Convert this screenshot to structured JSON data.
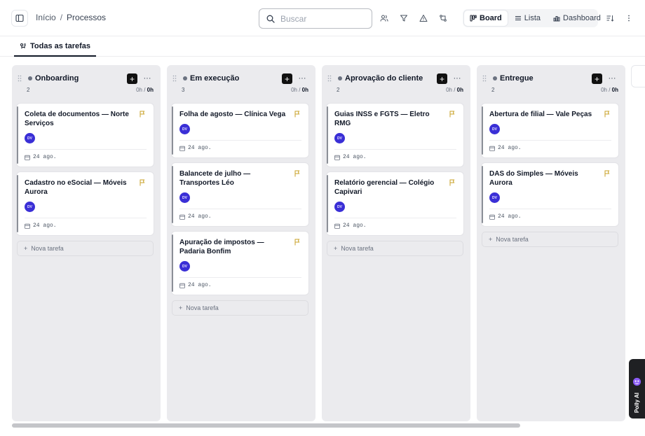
{
  "breadcrumb": {
    "home": "Início",
    "separator": "/",
    "current": "Processos"
  },
  "search": {
    "placeholder": "Buscar",
    "value": ""
  },
  "toolbar": {
    "icons": [
      "people-icon",
      "filter-icon",
      "warning-icon",
      "git-branch-icon",
      "sort-icon",
      "more-vertical-icon"
    ]
  },
  "views": [
    {
      "label": "Board",
      "icon": "board-icon",
      "active": true
    },
    {
      "label": "Lista",
      "icon": "list-icon",
      "active": false
    },
    {
      "label": "Dashboard",
      "icon": "dashboard-icon",
      "active": false
    }
  ],
  "subtab": {
    "label": "Todas as tarefas",
    "icon": "tasks-icon"
  },
  "columns": [
    {
      "title": "Onboarding",
      "count": "2",
      "hours": "0h",
      "hours_total": "0h",
      "cards": [
        {
          "title": "Coleta de documentos — Norte Serviços",
          "avatar": "DV",
          "date": "24 ago."
        },
        {
          "title": "Cadastro no eSocial — Móveis Aurora",
          "avatar": "DV",
          "date": "24 ago."
        }
      ],
      "new_task": "Nova tarefa"
    },
    {
      "title": "Em execução",
      "count": "3",
      "hours": "0h",
      "hours_total": "0h",
      "cards": [
        {
          "title": "Folha de agosto — Clínica Vega",
          "avatar": "DV",
          "date": "24 ago."
        },
        {
          "title": "Balancete de julho — Transportes Léo",
          "avatar": "DV",
          "date": "24 ago."
        },
        {
          "title": "Apuração de impostos — Padaria Bonfim",
          "avatar": "DV",
          "date": "24 ago."
        }
      ],
      "new_task": "Nova tarefa"
    },
    {
      "title": "Aprovação do cliente",
      "count": "2",
      "hours": "0h",
      "hours_total": "0h",
      "cards": [
        {
          "title": "Guias INSS e FGTS — Eletro RMG",
          "avatar": "DV",
          "date": "24 ago."
        },
        {
          "title": "Relatório gerencial — Colégio Capivari",
          "avatar": "DV",
          "date": "24 ago."
        }
      ],
      "new_task": "Nova tarefa"
    },
    {
      "title": "Entregue",
      "count": "2",
      "hours": "0h",
      "hours_total": "0h",
      "cards": [
        {
          "title": "Abertura de filial — Vale Peças",
          "avatar": "DV",
          "date": "24 ago."
        },
        {
          "title": "DAS do Simples — Móveis Aurora",
          "avatar": "DV",
          "date": "24 ago."
        }
      ],
      "new_task": "Nova tarefa"
    }
  ],
  "assistant": {
    "label": "Polly AI"
  },
  "colors": {
    "avatar": "#3a2fd6",
    "flag": "#c9a227",
    "column_bg": "#ebebee"
  }
}
